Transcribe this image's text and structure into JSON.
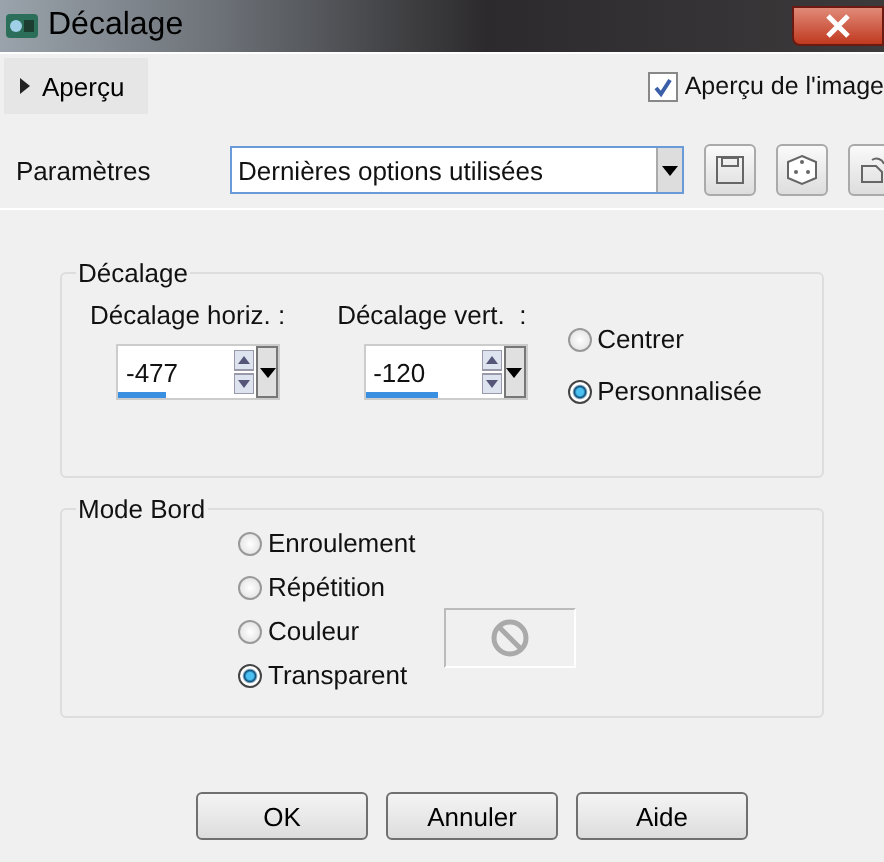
{
  "window": {
    "title": "Décalage"
  },
  "preview": {
    "label": "Aperçu",
    "expanded": false,
    "image_preview": {
      "label": "Aperçu de l'image",
      "checked": true
    }
  },
  "presets": {
    "label": "Paramètres",
    "value": "Dernières options utilisées"
  },
  "offset_group": {
    "title": "Décalage",
    "fields": [
      {
        "label": "Décalage horiz. :",
        "value": "-477",
        "level": 0.3
      },
      {
        "label": "Décalage vert.  :",
        "value": "-120",
        "level": 0.45
      }
    ],
    "options": [
      {
        "label": "Centrer",
        "selected": false
      },
      {
        "label": "Personnalisée",
        "selected": true
      }
    ]
  },
  "edge_group": {
    "title": "Mode Bord",
    "options": [
      {
        "label": "Enroulement",
        "selected": false
      },
      {
        "label": "Répétition",
        "selected": false
      },
      {
        "label": "Couleur",
        "selected": false
      },
      {
        "label": "Transparent",
        "selected": true
      }
    ]
  },
  "buttons": [
    "OK",
    "Annuler",
    "Aide"
  ]
}
